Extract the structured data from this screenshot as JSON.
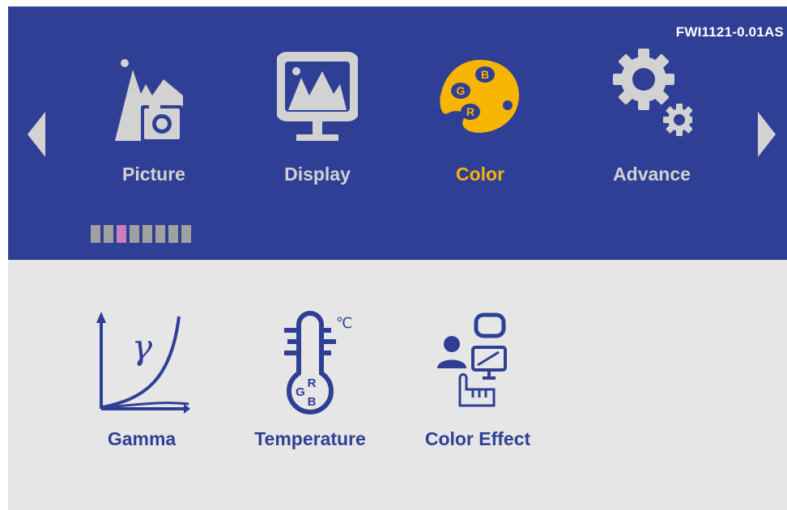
{
  "header": {
    "version": "FWI1121-0.01AS"
  },
  "tabs": [
    {
      "label": "Picture",
      "icon": "picture-icon",
      "active": false
    },
    {
      "label": "Display",
      "icon": "display-icon",
      "active": false
    },
    {
      "label": "Color",
      "icon": "color-palette-icon",
      "active": true
    },
    {
      "label": "Advance",
      "icon": "gears-icon",
      "active": false
    }
  ],
  "color_palette_letters": {
    "r": "R",
    "g": "G",
    "b": "B"
  },
  "pager": {
    "count": 8,
    "active_index": 2
  },
  "submenu": [
    {
      "label": "Gamma",
      "icon": "gamma-curve-icon",
      "symbol": "γ"
    },
    {
      "label": "Temperature",
      "icon": "thermometer-icon",
      "unit": "℃",
      "letters": {
        "r": "R",
        "g": "G",
        "b": "B"
      }
    },
    {
      "label": "Color Effect",
      "icon": "color-effect-icon"
    }
  ],
  "colors": {
    "header_bg": "#2f3f95",
    "body_bg": "#e6e6e6",
    "active_tab": "#f7b400",
    "inactive_tab": "#d2d2d2",
    "submenu_ink": "#2f3f95",
    "pager_active": "#c77fc0",
    "pager_inactive": "#a0a0a0"
  }
}
